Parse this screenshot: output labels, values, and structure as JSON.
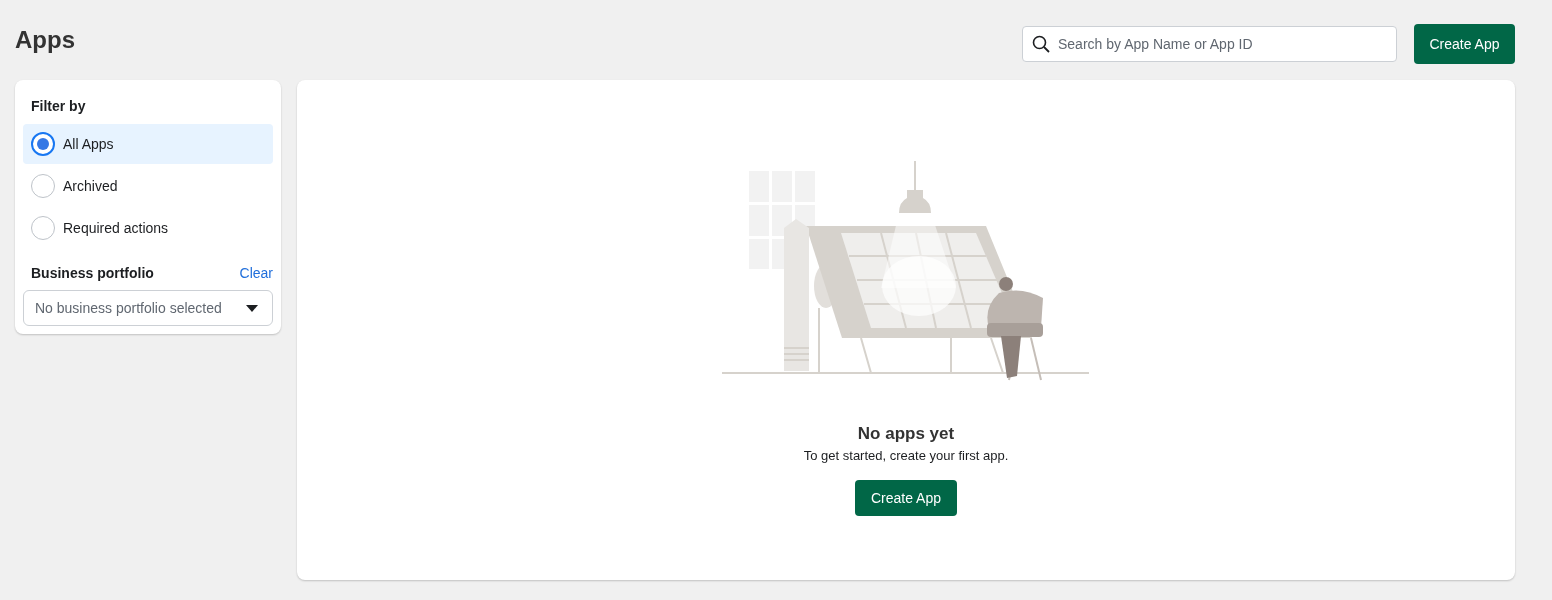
{
  "page": {
    "title": "Apps"
  },
  "search": {
    "placeholder": "Search by App Name or App ID"
  },
  "header_button": "Create App",
  "filter": {
    "heading": "Filter by",
    "options": [
      {
        "label": "All Apps",
        "selected": true
      },
      {
        "label": "Archived",
        "selected": false
      },
      {
        "label": "Required actions",
        "selected": false
      }
    ],
    "portfolio_heading": "Business portfolio",
    "clear_link": "Clear",
    "portfolio_select": {
      "placeholder": "No business portfolio selected"
    }
  },
  "empty_state": {
    "title": "No apps yet",
    "subtitle": "To get started, create your first app.",
    "button": "Create App"
  }
}
